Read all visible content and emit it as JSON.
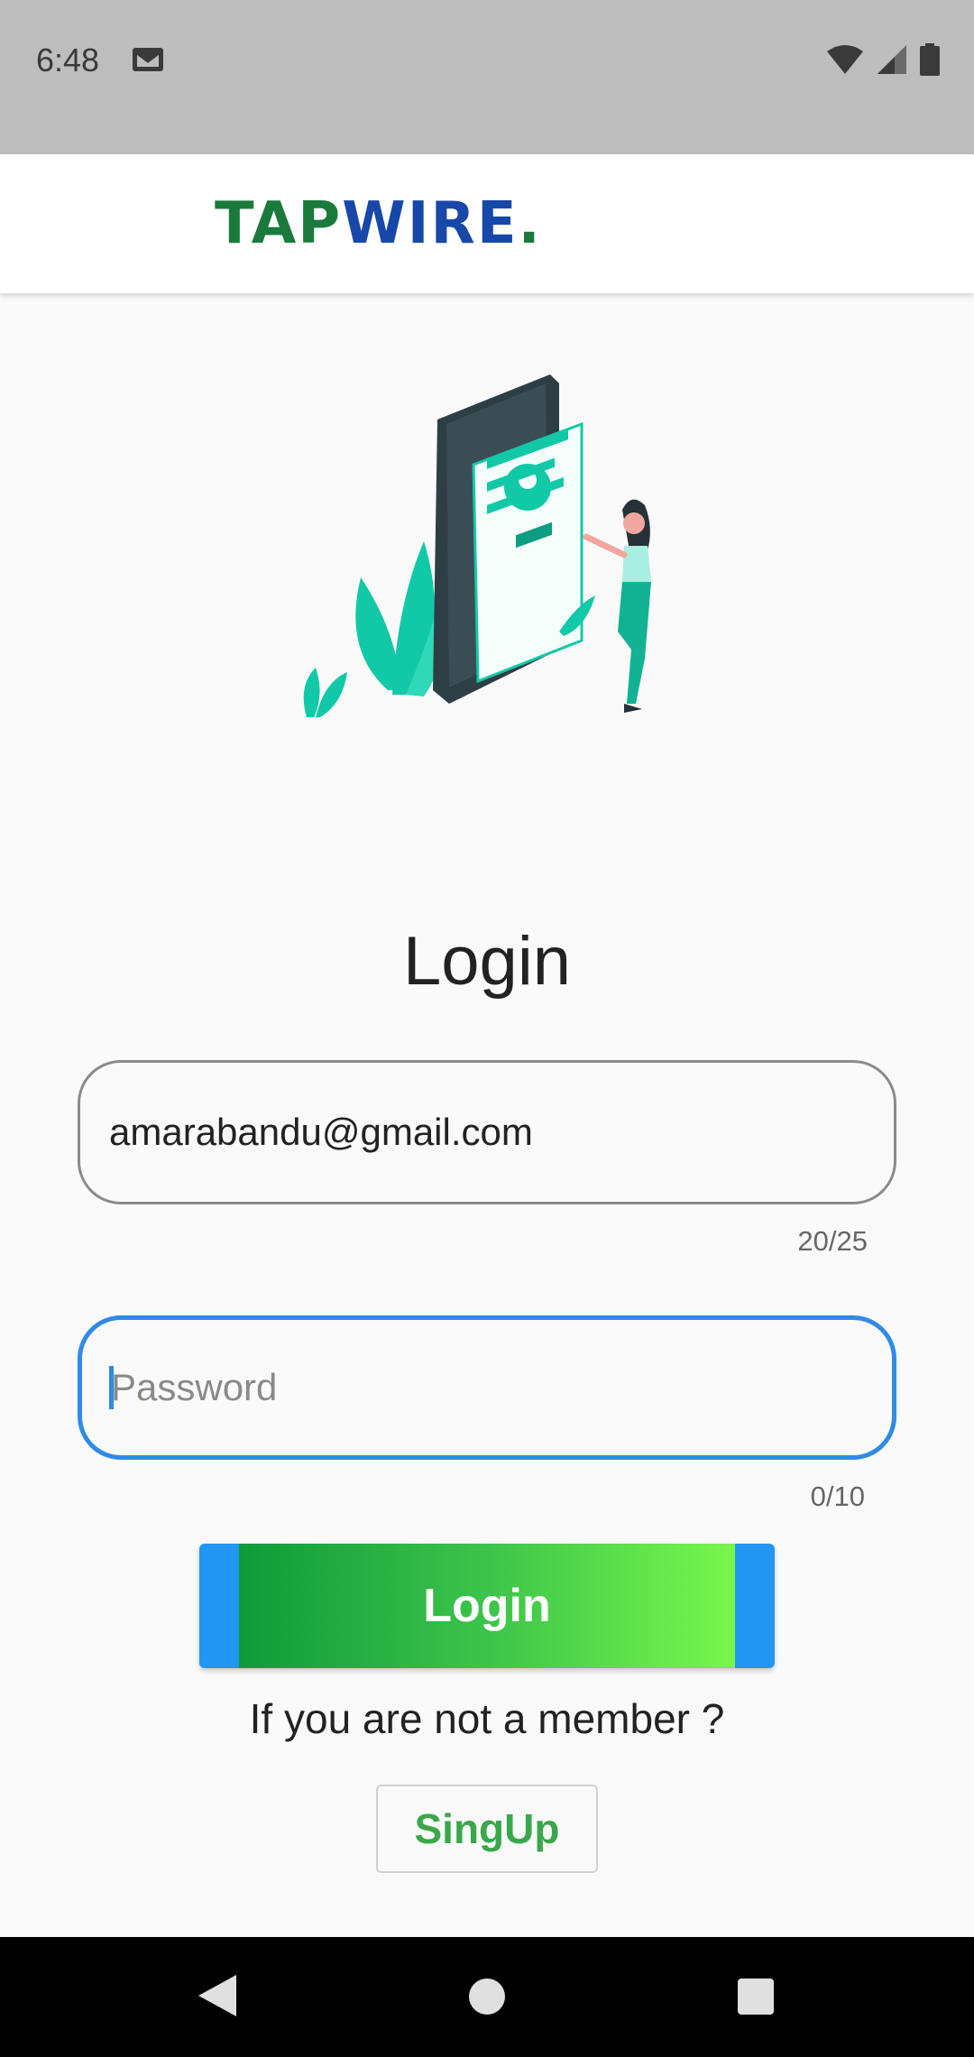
{
  "status_bar": {
    "time": "6:48",
    "icons": [
      "gmail-icon",
      "wifi-icon",
      "signal-icon",
      "battery-icon"
    ]
  },
  "app_bar": {
    "logo": {
      "part1": "TAP",
      "part2": "WIRE",
      "part3": "."
    }
  },
  "illustration": {
    "icon": "login-illustration"
  },
  "form": {
    "title": "Login",
    "email": {
      "value": "amarabandu@gmail.com",
      "counter": "20/25"
    },
    "password": {
      "placeholder": "Password",
      "value": "",
      "counter": "0/10"
    },
    "login_label": "Login",
    "member_text": "If you are not a member ?",
    "signup_label": "SingUp"
  },
  "colors": {
    "accent_blue": "#2f8be6",
    "button_blue": "#2196f3",
    "gradient_start": "#0f9a3a",
    "gradient_end": "#79f74c",
    "signup_green": "#3aa84a",
    "logo_green": "#1a7a3c",
    "logo_blue": "#1747a8"
  },
  "nav_bar": {
    "icons": [
      "back-icon",
      "home-icon",
      "recents-icon"
    ]
  }
}
